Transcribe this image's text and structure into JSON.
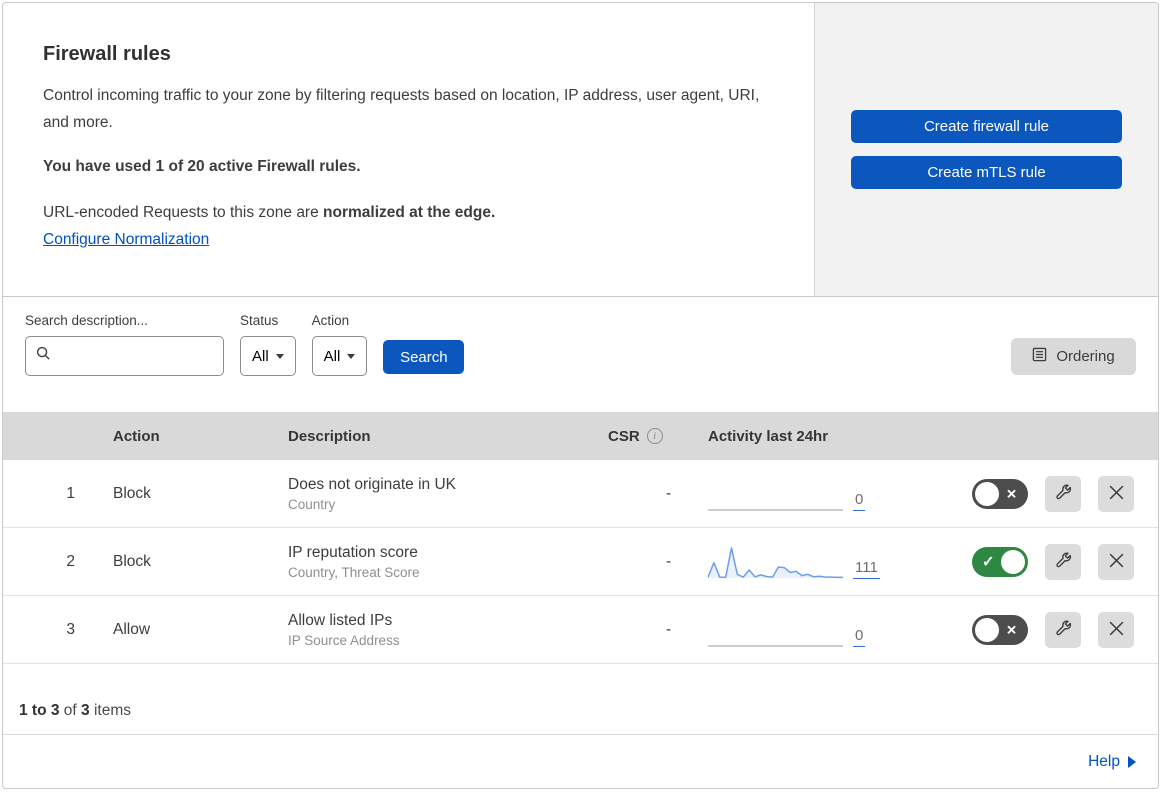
{
  "header": {
    "title": "Firewall rules",
    "description": "Control incoming traffic to your zone by filtering requests based on location, IP address, user agent, URI, and more.",
    "usage": "You have used 1 of 20 active Firewall rules.",
    "normalization_prefix": "URL-encoded Requests to this zone are ",
    "normalization_bold": "normalized at the edge.",
    "normalization_link": "Configure Normalization",
    "create_firewall_button": "Create firewall rule",
    "create_mtls_button": "Create mTLS rule"
  },
  "filters": {
    "search_label": "Search description...",
    "status_label": "Status",
    "status_value": "All",
    "action_label": "Action",
    "action_value": "All",
    "search_button": "Search",
    "ordering_button": "Ordering"
  },
  "table": {
    "columns": {
      "action": "Action",
      "description": "Description",
      "csr": "CSR",
      "activity": "Activity last 24hr"
    },
    "rows": [
      {
        "priority": "1",
        "action": "Block",
        "description": "Does not originate in UK",
        "criteria": "Country",
        "csr": "-",
        "activity": {
          "count": "0",
          "values": [
            0,
            0,
            0,
            0,
            0,
            0,
            0,
            0,
            0,
            0,
            0,
            0,
            0,
            0,
            0,
            0,
            0,
            0,
            0,
            0,
            0,
            0,
            0,
            0
          ]
        },
        "enabled": false
      },
      {
        "priority": "2",
        "action": "Block",
        "description": "IP reputation score",
        "criteria": "Country, Threat Score",
        "csr": "-",
        "activity": {
          "count": "111",
          "values": [
            2,
            50,
            3,
            2,
            98,
            12,
            3,
            26,
            4,
            10,
            5,
            3,
            36,
            34,
            18,
            22,
            8,
            12,
            4,
            6,
            3,
            3,
            2,
            2
          ]
        },
        "enabled": true
      },
      {
        "priority": "3",
        "action": "Allow",
        "description": "Allow listed IPs",
        "criteria": "IP Source Address",
        "csr": "-",
        "activity": {
          "count": "0",
          "values": [
            0,
            0,
            0,
            0,
            0,
            0,
            0,
            0,
            0,
            0,
            0,
            0,
            0,
            0,
            0,
            0,
            0,
            0,
            0,
            0,
            0,
            0,
            0,
            0
          ]
        },
        "enabled": false
      }
    ]
  },
  "pagination": {
    "range": "1 to 3",
    "of_label": " of ",
    "total": "3",
    "items_label": " items"
  },
  "footer": {
    "help_label": "Help"
  },
  "colors": {
    "accent_blue": "#0b57be",
    "link_blue": "#0051c3",
    "toggle_on_green": "#2e8743",
    "toggle_off_gray": "#4d4d4d",
    "header_band_gray": "#d9d9d9",
    "panel_gray": "#f2f2f2",
    "sparkline_blue": "#6f9ee8"
  }
}
